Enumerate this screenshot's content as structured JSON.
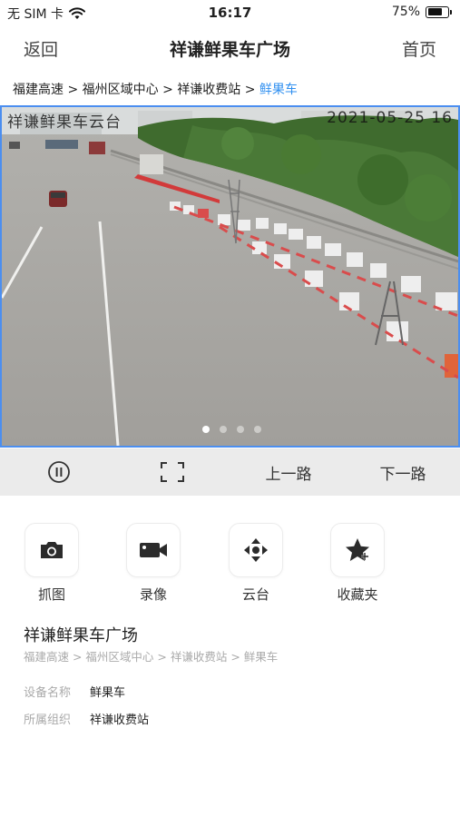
{
  "status": {
    "carrier": "无 SIM 卡",
    "time": "16:17",
    "battery": "75%",
    "battery_level": 0.75
  },
  "nav": {
    "back": "返回",
    "title": "祥谦鲜果车广场",
    "home": "首页"
  },
  "breadcrumb": {
    "items": [
      "福建高速",
      "福州区域中心",
      "祥谦收费站",
      "鲜果车"
    ],
    "separator": " > "
  },
  "video": {
    "osd_left": "祥谦鲜果车云台",
    "osd_right": "2021-05-25 16",
    "pages": 4,
    "current_page": 1
  },
  "controls": {
    "pause_icon": "pause-circle-icon",
    "fullscreen_icon": "fullscreen-icon",
    "prev": "上一路",
    "next": "下一路"
  },
  "actions": [
    {
      "label": "抓图",
      "icon": "camera-icon"
    },
    {
      "label": "录像",
      "icon": "video-camera-icon"
    },
    {
      "label": "云台",
      "icon": "ptz-direction-icon"
    },
    {
      "label": "收藏夹",
      "icon": "star-icon"
    }
  ],
  "info": {
    "title": "祥谦鲜果车广场",
    "path": "福建高速 > 福州区域中心 > 祥谦收费站 > 鲜果车",
    "device_label": "设备名称",
    "device_value": "鲜果车",
    "org_label": "所属组织",
    "org_value": "祥谦收费站"
  },
  "colors": {
    "accent": "#2f8ff0",
    "control_bar": "#ebebeb",
    "video_border": "#4b8ef0"
  }
}
